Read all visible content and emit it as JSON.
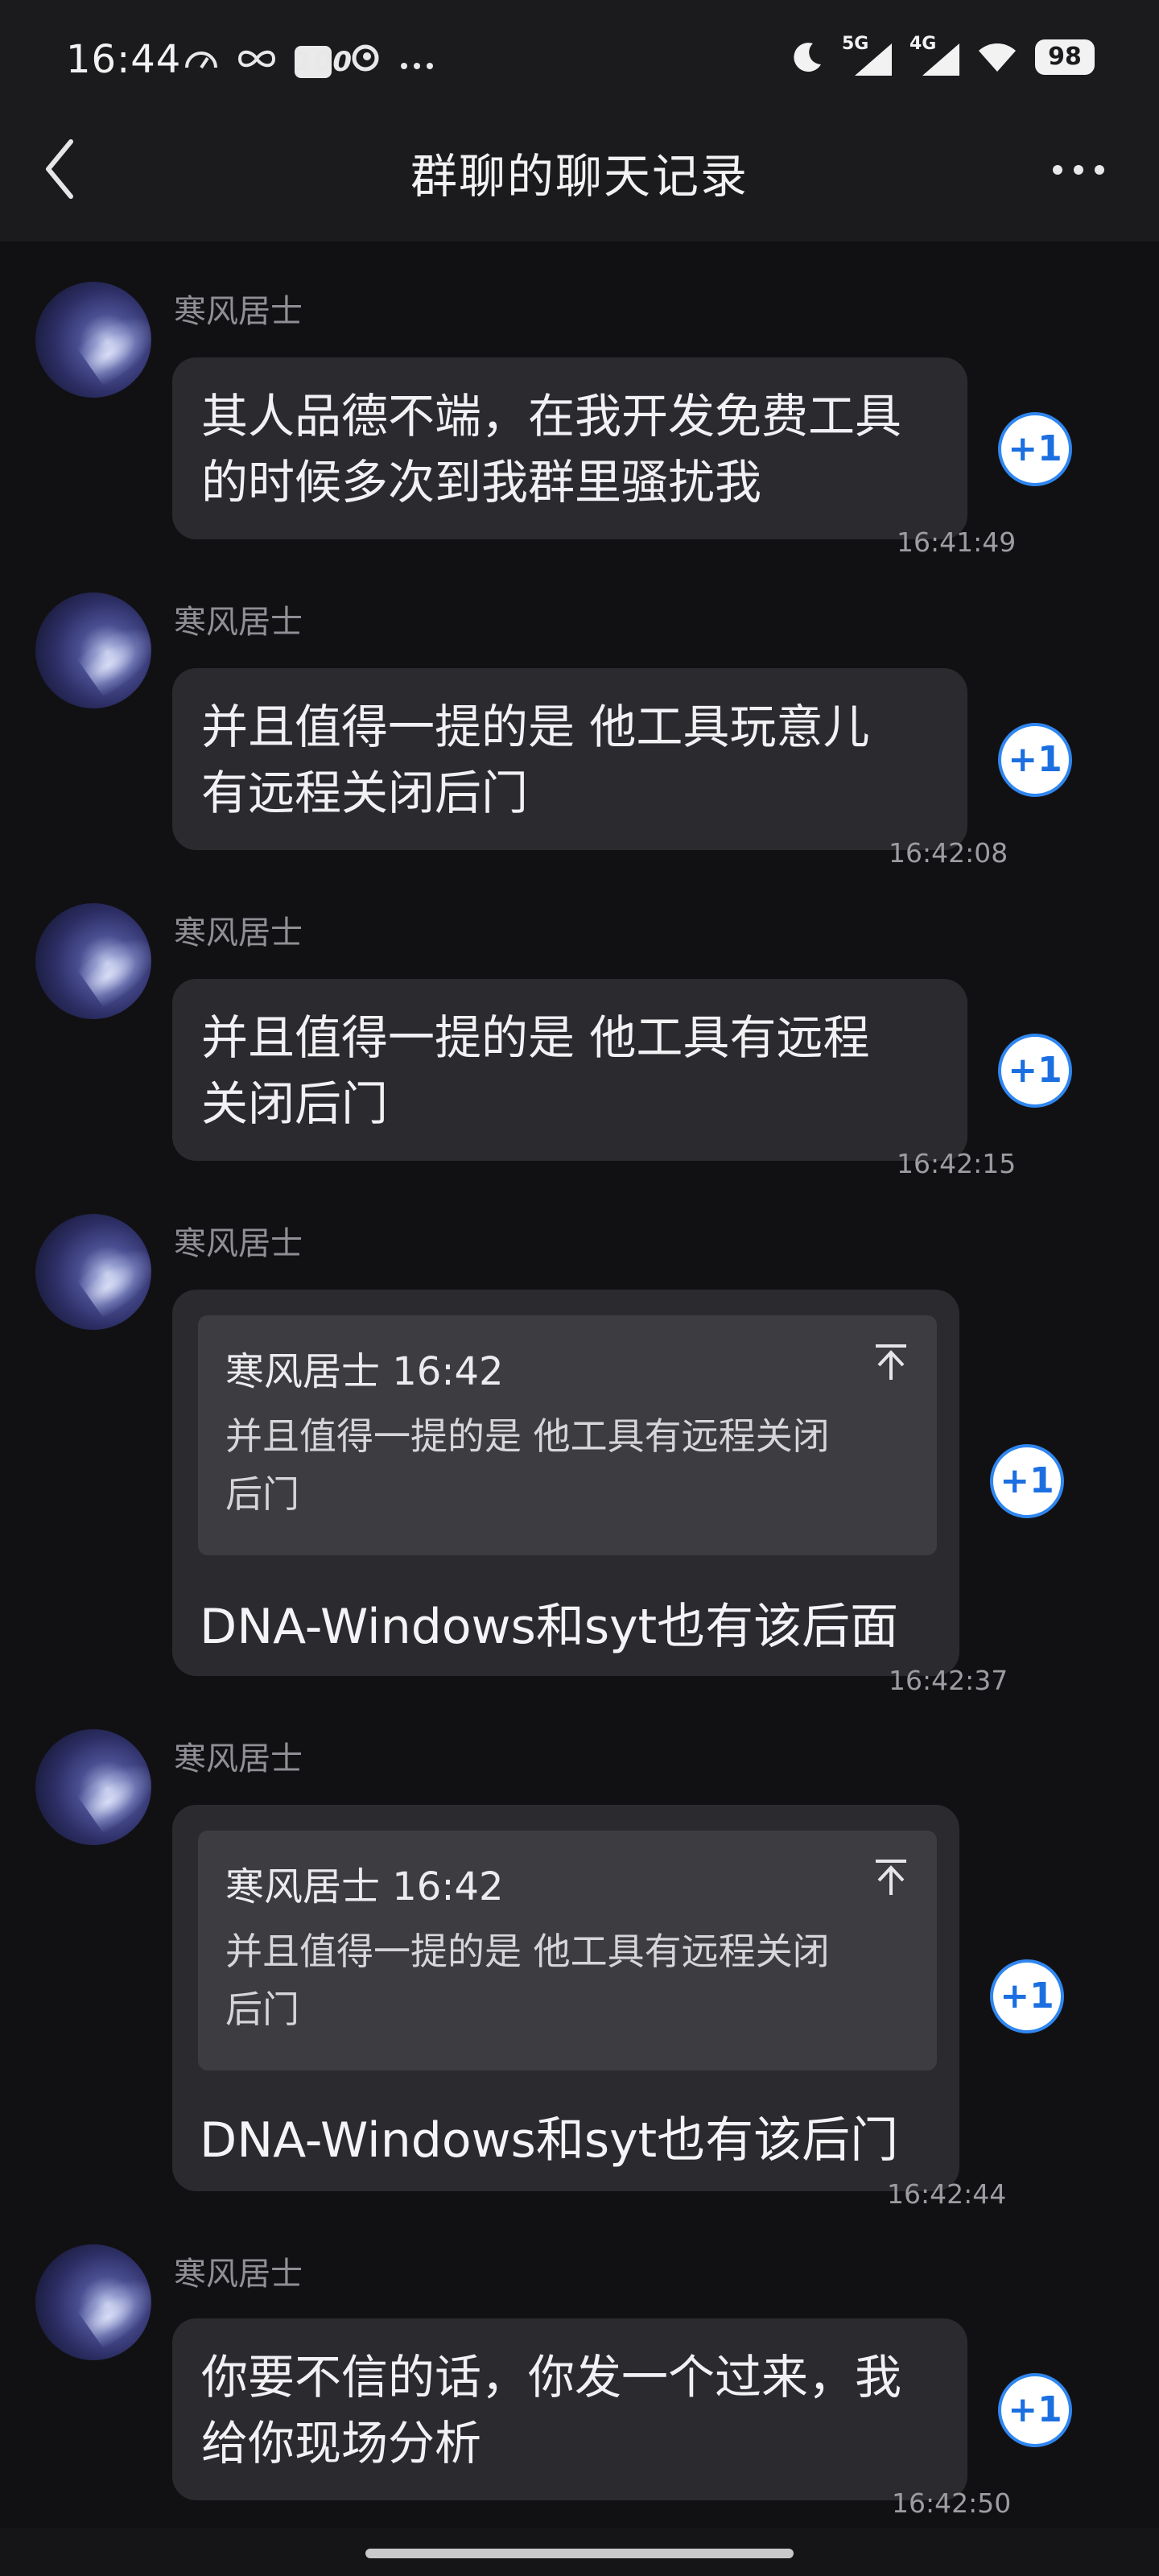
{
  "status_bar": {
    "time": "16:44",
    "left_icons": [
      "speedometer-icon",
      "infinity-icon",
      "hundred-points-icon",
      "swirl-icon",
      "more-dots-icon"
    ],
    "badge_100": "100",
    "signal_1_label": "5G",
    "signal_2_label": "4G",
    "battery": "98"
  },
  "header": {
    "title": "群聊的聊天记录"
  },
  "messages": [
    {
      "sender": "寒风居士",
      "text": "其人品德不端，在我开发免费工具\n的时候多次到我群里骚扰我",
      "time": "16:41:49",
      "plus_one": "+1"
    },
    {
      "sender": "寒风居士",
      "text": "并且值得一提的是 他工具玩意儿\n有远程关闭后门",
      "time": "16:42:08",
      "plus_one": "+1"
    },
    {
      "sender": "寒风居士",
      "text": "并且值得一提的是 他工具有远程\n关闭后门",
      "time": "16:42:15",
      "plus_one": "+1"
    },
    {
      "sender": "寒风居士",
      "quote_head": "寒风居士 16:42",
      "quote_text": "并且值得一提的是 他工具有远程关闭\n后门",
      "text": "DNA-Windows和syt也有该后面",
      "time": "16:42:37",
      "plus_one": "+1"
    },
    {
      "sender": "寒风居士",
      "quote_head": "寒风居士 16:42",
      "quote_text": "并且值得一提的是 他工具有远程关闭\n后门",
      "text": "DNA-Windows和syt也有该后门",
      "time": "16:42:44",
      "plus_one": "+1"
    },
    {
      "sender": "寒风居士",
      "text": "你要不信的话，你发一个过来，我\n给你现场分析",
      "time": "16:42:50",
      "plus_one": "+1"
    }
  ],
  "colors": {
    "background": "#111114",
    "bar": "#1b1b1e",
    "bubble": "#2b2b2f",
    "quote": "#3c3c41",
    "accent_blue": "#2f86f0"
  }
}
